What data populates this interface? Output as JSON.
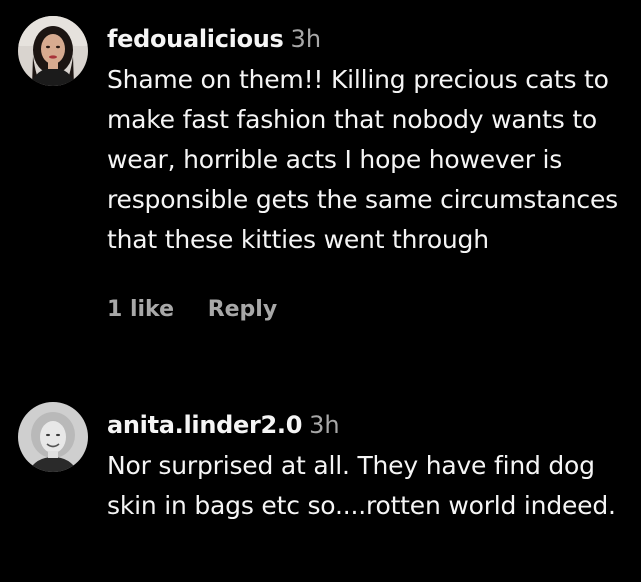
{
  "comments": [
    {
      "username": "fedoualicious",
      "time": "3h",
      "text": "Shame on them!! Killing precious cats to make fast fashion that nobody wants to wear, horrible acts I hope however is responsible gets the same circumstances that these kitties went through",
      "likes": "1 like",
      "reply": "Reply"
    },
    {
      "username": "anita.linder2.0",
      "time": "3h",
      "text": "Nor surprised at all. They have find dog skin in bags etc so....rotten world indeed."
    }
  ],
  "colors": {
    "background": "#000000",
    "primary_text": "#f5f5f5",
    "secondary_text": "#a8a8a8"
  }
}
